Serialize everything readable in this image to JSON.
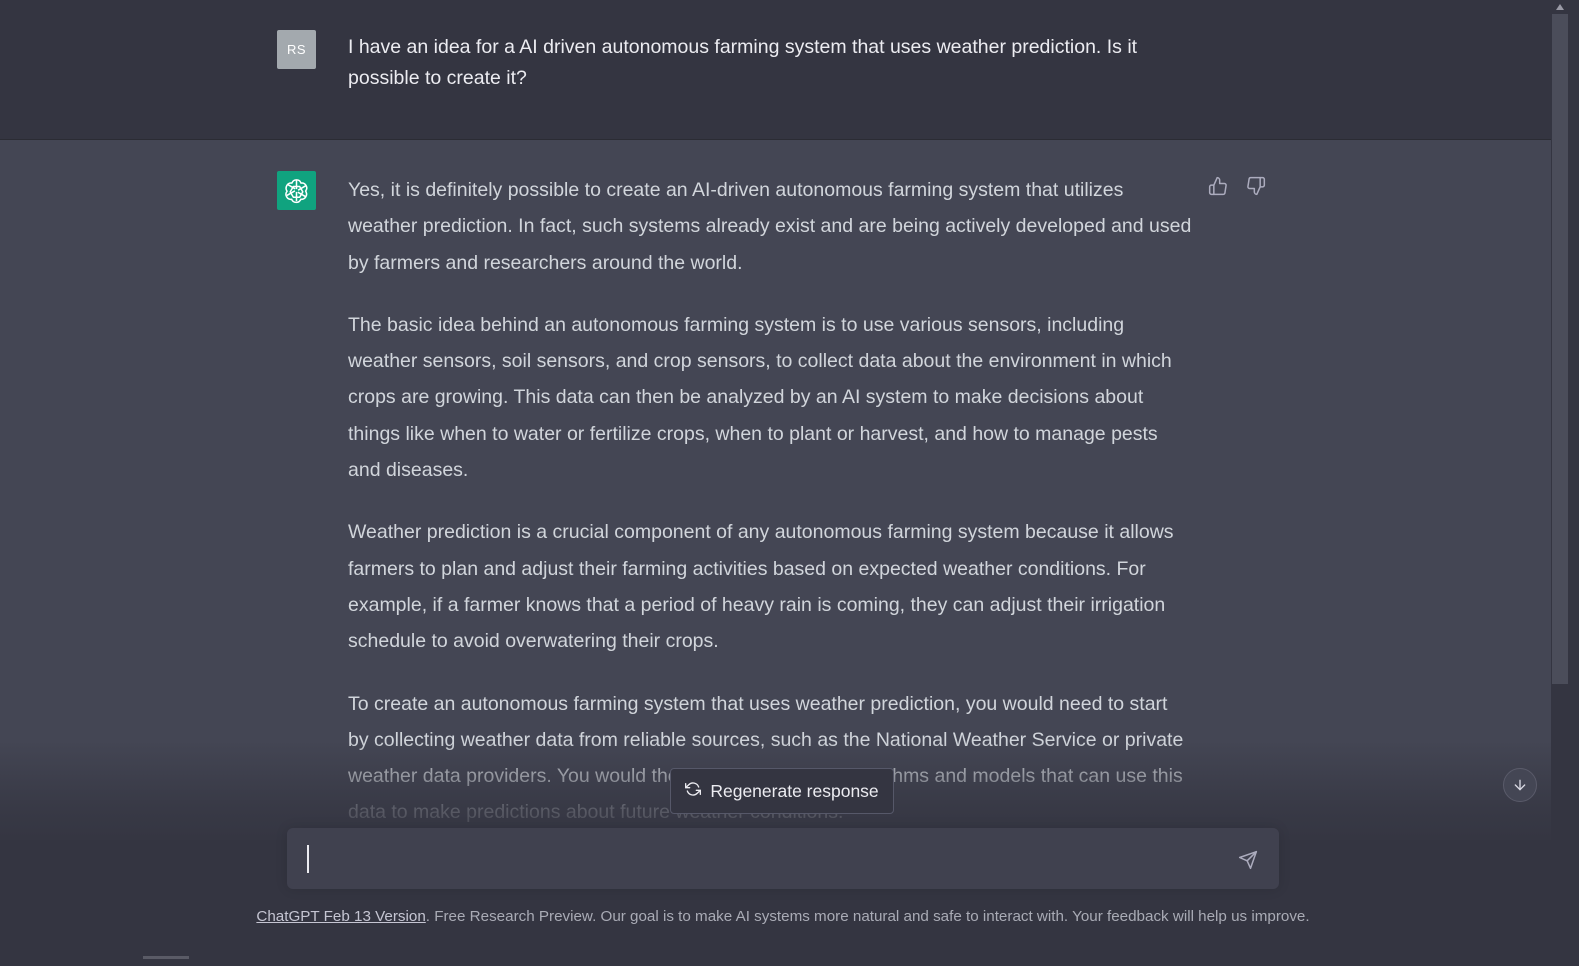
{
  "user_message": {
    "avatar_initials": "RS",
    "text": "I have an idea for a AI driven autonomous farming system that uses weather prediction. Is it possible to create it?"
  },
  "assistant_message": {
    "paragraphs": [
      "Yes, it is definitely possible to create an AI-driven autonomous farming system that utilizes weather prediction. In fact, such systems already exist and are being actively developed and used by farmers and researchers around the world.",
      "The basic idea behind an autonomous farming system is to use various sensors, including weather sensors, soil sensors, and crop sensors, to collect data about the environment in which crops are growing. This data can then be analyzed by an AI system to make decisions about things like when to water or fertilize crops, when to plant or harvest, and how to manage pests and diseases.",
      "Weather prediction is a crucial component of any autonomous farming system because it allows farmers to plan and adjust their farming activities based on expected weather conditions. For example, if a farmer knows that a period of heavy rain is coming, they can adjust their irrigation schedule to avoid overwatering their crops.",
      "To create an autonomous farming system that uses weather prediction, you would need to start by collecting weather data from reliable sources, such as the National Weather Service or private weather data providers. You would then need to develop algorithms and models that can use this data to make predictions about future weather conditions."
    ],
    "icons": {
      "thumbs_up": "thumbs-up-icon",
      "thumbs_down": "thumbs-down-icon",
      "avatar": "openai-logo-icon"
    }
  },
  "controls": {
    "regenerate_label": "Regenerate response",
    "input_placeholder": "",
    "input_value": "",
    "send_icon": "send-icon",
    "scroll_down_icon": "arrow-down-icon"
  },
  "footer": {
    "version_link": "ChatGPT Feb 13 Version",
    "text": ". Free Research Preview. Our goal is to make AI systems more natural and safe to interact with. Your feedback will help us improve."
  },
  "colors": {
    "background": "#343541",
    "assistant_background": "#444654",
    "brand_green": "#10a37f",
    "user_avatar": "#a3a9ae"
  }
}
